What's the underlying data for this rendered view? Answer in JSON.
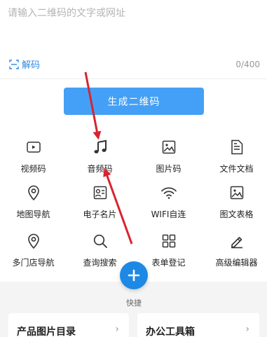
{
  "input": {
    "placeholder": "请输入二维码的文字或网址",
    "value": "",
    "char_count": "0/400"
  },
  "decode_label": "解码",
  "generate_label": "生成二维码",
  "tools": [
    {
      "label": "视频码",
      "icon": "video-icon"
    },
    {
      "label": "音频码",
      "icon": "music-note-icon"
    },
    {
      "label": "图片码",
      "icon": "image-icon"
    },
    {
      "label": "文件文档",
      "icon": "document-icon"
    },
    {
      "label": "地图导航",
      "icon": "map-pin-icon"
    },
    {
      "label": "电子名片",
      "icon": "business-card-icon"
    },
    {
      "label": "WIFI自连",
      "icon": "wifi-icon"
    },
    {
      "label": "图文表格",
      "icon": "image-table-icon"
    },
    {
      "label": "多门店导航",
      "icon": "multi-store-pin-icon"
    },
    {
      "label": "查询搜索",
      "icon": "search-icon"
    },
    {
      "label": "表单登记",
      "icon": "grid-form-icon"
    },
    {
      "label": "高级编辑器",
      "icon": "pen-icon"
    }
  ],
  "fab": {
    "label": "快捷",
    "icon": "plus-icon"
  },
  "cards": [
    {
      "title": "产品图片目录"
    },
    {
      "title": "办公工具箱"
    }
  ],
  "colors": {
    "accent": "#44a0f6",
    "fab": "#1e88e5",
    "decode_link": "#2f8ae5",
    "annotation_arrow": "#d9232f"
  }
}
